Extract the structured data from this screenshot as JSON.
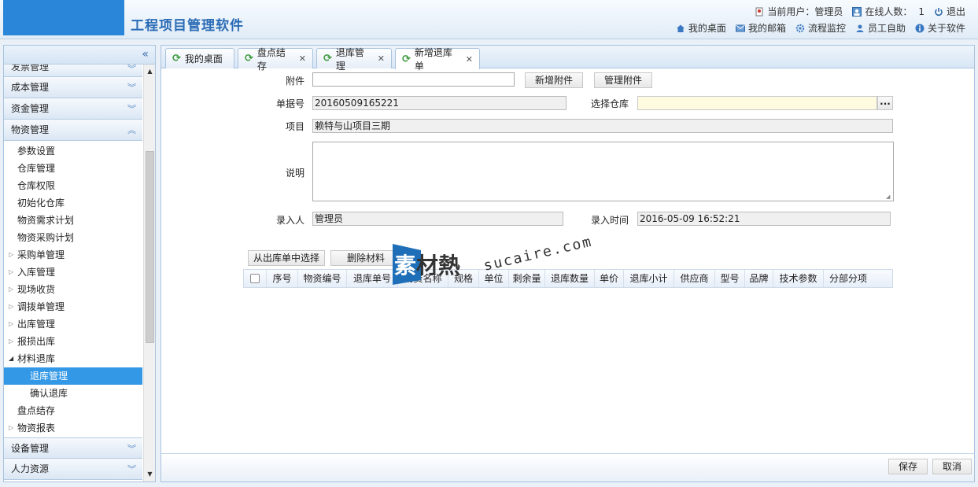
{
  "header": {
    "app_title": "工程项目管理软件",
    "current_user_label": "当前用户：管理员",
    "online_label": "在线人数：",
    "online_count": "1",
    "logout_label": "退出",
    "nav": [
      "我的桌面",
      "我的邮箱",
      "流程监控",
      "员工自助",
      "关于软件"
    ]
  },
  "sidebar": {
    "collapse_glyph": "«",
    "cut_item": "发票管理",
    "heads_top": [
      "成本管理",
      "资金管理",
      "物资管理"
    ],
    "items": [
      {
        "label": "参数设置"
      },
      {
        "label": "仓库管理"
      },
      {
        "label": "仓库权限"
      },
      {
        "label": "初始化仓库"
      },
      {
        "label": "物资需求计划"
      },
      {
        "label": "物资采购计划"
      },
      {
        "label": "采购单管理"
      },
      {
        "label": "入库管理"
      },
      {
        "label": "现场收货"
      },
      {
        "label": "调拨单管理"
      },
      {
        "label": "出库管理"
      },
      {
        "label": "报损出库"
      },
      {
        "label": "材料退库"
      },
      {
        "label": "退库管理"
      },
      {
        "label": "确认退库"
      },
      {
        "label": "盘点结存"
      },
      {
        "label": "物资报表"
      }
    ],
    "heads_bottom": [
      "设备管理",
      "人力资源"
    ]
  },
  "tabs": [
    {
      "label": "我的桌面"
    },
    {
      "label": "盘点结存"
    },
    {
      "label": "退库管理"
    },
    {
      "label": "新增退库单"
    }
  ],
  "form": {
    "attachment_label": "附件",
    "attachment_value": "",
    "add_attachment_button": "新增附件",
    "manage_attachment_button": "管理附件",
    "doc_no_label": "单据号",
    "doc_no_value": "20160509165221",
    "warehouse_label": "选择仓库",
    "warehouse_value": "",
    "warehouse_picker": "...",
    "project_label": "项目",
    "project_value": "赖特与山项目三期",
    "note_label": "说明",
    "entered_by_label": "录入人",
    "entered_by_value": "管理员",
    "entry_time_label": "录入时间",
    "entry_time_value": "2016-05-09 16:52:21",
    "select_from_outbound_button": "从出库单中选择",
    "delete_material_button": "删除材料"
  },
  "grid": {
    "columns": [
      "序号",
      "物资编号",
      "退库单号",
      "物资名称",
      "规格",
      "单位",
      "剩余量",
      "退库数量",
      "单价",
      "退库小计",
      "供应商",
      "型号",
      "品牌",
      "技术参数",
      "分部分项"
    ],
    "rows": []
  },
  "watermark": {
    "text_first": "素",
    "text_rest": "材熱",
    "url": "sucaire.com"
  },
  "footer": {
    "save_button": "保存",
    "cancel_button": "取消"
  }
}
